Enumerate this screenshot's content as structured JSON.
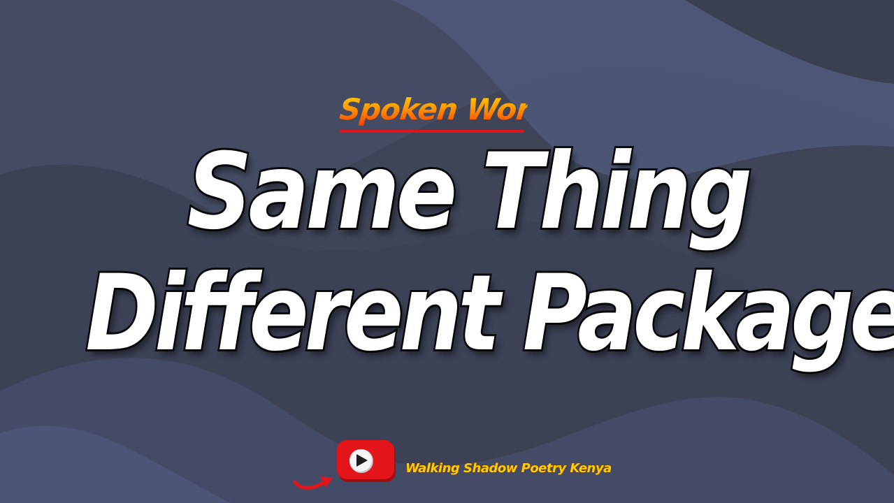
{
  "background": {
    "base_color": "#3f4458",
    "band_color": "#4e5878"
  },
  "subtitle": {
    "text": "Spoken Word",
    "underline_color": "#e0141b"
  },
  "title": {
    "line1": "Same Thing",
    "line2": "Different Package",
    "fill_color": "#ffffff",
    "stroke_color": "#0b0b0d"
  },
  "footer": {
    "logo_icon": "youtube-play-icon",
    "arrow_icon": "curved-arrow-icon",
    "channel_name": "Walking Shadow Poetry Kenya",
    "channel_color": "#ffcc00",
    "logo_color": "#e4141b"
  }
}
